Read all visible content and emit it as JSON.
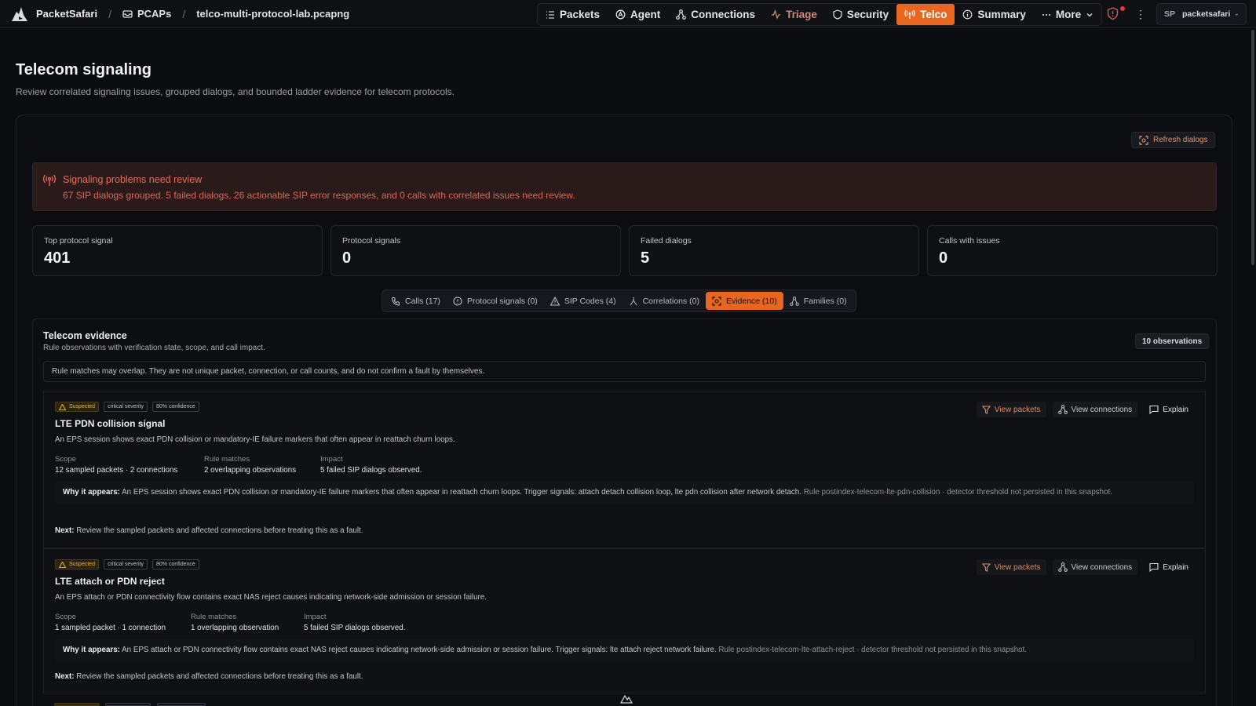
{
  "app": {
    "name": "PacketSafari",
    "breadcrumb_pcaps": "PCAPs",
    "breadcrumb_file": "telco-multi-protocol-lab.pcapng"
  },
  "nav": {
    "items": [
      "Packets",
      "Agent",
      "Connections",
      "Triage",
      "Security",
      "Telco",
      "Summary",
      "More"
    ],
    "active": "Telco"
  },
  "user": {
    "initials": "SP",
    "name": "packetsafari"
  },
  "page": {
    "title": "Telecom signaling",
    "subtitle": "Review correlated signaling issues, grouped dialogs, and bounded ladder evidence for telecom protocols."
  },
  "refresh_label": "Refresh dialogs",
  "banner": {
    "title": "Signaling problems need review",
    "description": "67 SIP dialogs grouped. 5 failed dialogs, 26 actionable SIP error responses, and 0 calls with correlated issues need review."
  },
  "stats": [
    {
      "label": "Top protocol signal",
      "value": "401"
    },
    {
      "label": "Protocol signals",
      "value": "0"
    },
    {
      "label": "Failed dialogs",
      "value": "5"
    },
    {
      "label": "Calls with issues",
      "value": "0"
    }
  ],
  "tabs": [
    "Calls (17)",
    "Protocol signals (0)",
    "SIP Codes (4)",
    "Correlations (0)",
    "Evidence (10)",
    "Families (0)"
  ],
  "evidence": {
    "title": "Telecom evidence",
    "subtitle": "Rule observations with verification state, scope, and call impact.",
    "count_label": "10 observations",
    "note": "Rule matches may overlap. They are not unique packet, connection, or call counts, and do not confirm a fault by themselves.",
    "labels": {
      "scope": "Scope",
      "rule_matches": "Rule matches",
      "impact": "Impact",
      "why": "Why it appears:",
      "next": "Next:",
      "view_packets": "View packets",
      "view_connections": "View connections",
      "explain": "Explain"
    },
    "observations": [
      {
        "status": "Suspected",
        "severity": "critical severity",
        "confidence": "80% confidence",
        "title": "LTE PDN collision signal",
        "description": "An EPS session shows exact PDN collision or mandatory-IE failure markers that often appear in reattach churn loops.",
        "scope": "12 sampled packets · 2 connections",
        "rule_matches": "2 overlapping observations",
        "impact": "5 failed SIP dialogs observed.",
        "why": "An EPS session shows exact PDN collision or mandatory-IE failure markers that often appear in reattach churn loops. Trigger signals: attach detach collision loop, lte pdn collision after network detach.",
        "rule": "Rule postindex-telecom-lte-pdn-collision · detector threshold not persisted in this snapshot.",
        "next": "Review the sampled packets and affected connections before treating this as a fault."
      },
      {
        "status": "Suspected",
        "severity": "critical severity",
        "confidence": "80% confidence",
        "title": "LTE attach or PDN reject",
        "description": "An EPS attach or PDN connectivity flow contains exact NAS reject causes indicating network-side admission or session failure.",
        "scope": "1 sampled packet · 1 connection",
        "rule_matches": "1 overlapping observation",
        "impact": "5 failed SIP dialogs observed.",
        "why": "An EPS attach or PDN connectivity flow contains exact NAS reject causes indicating network-side admission or session failure. Trigger signals: lte attach reject network failure.",
        "rule": "Rule postindex-telecom-lte-attach-reject · detector threshold not persisted in this snapshot.",
        "next": "Review the sampled packets and affected connections before treating this as a fault."
      }
    ]
  },
  "colors": {
    "accent": "#e8661f",
    "danger": "#ef6b5a",
    "warning": "#e4b63f"
  }
}
